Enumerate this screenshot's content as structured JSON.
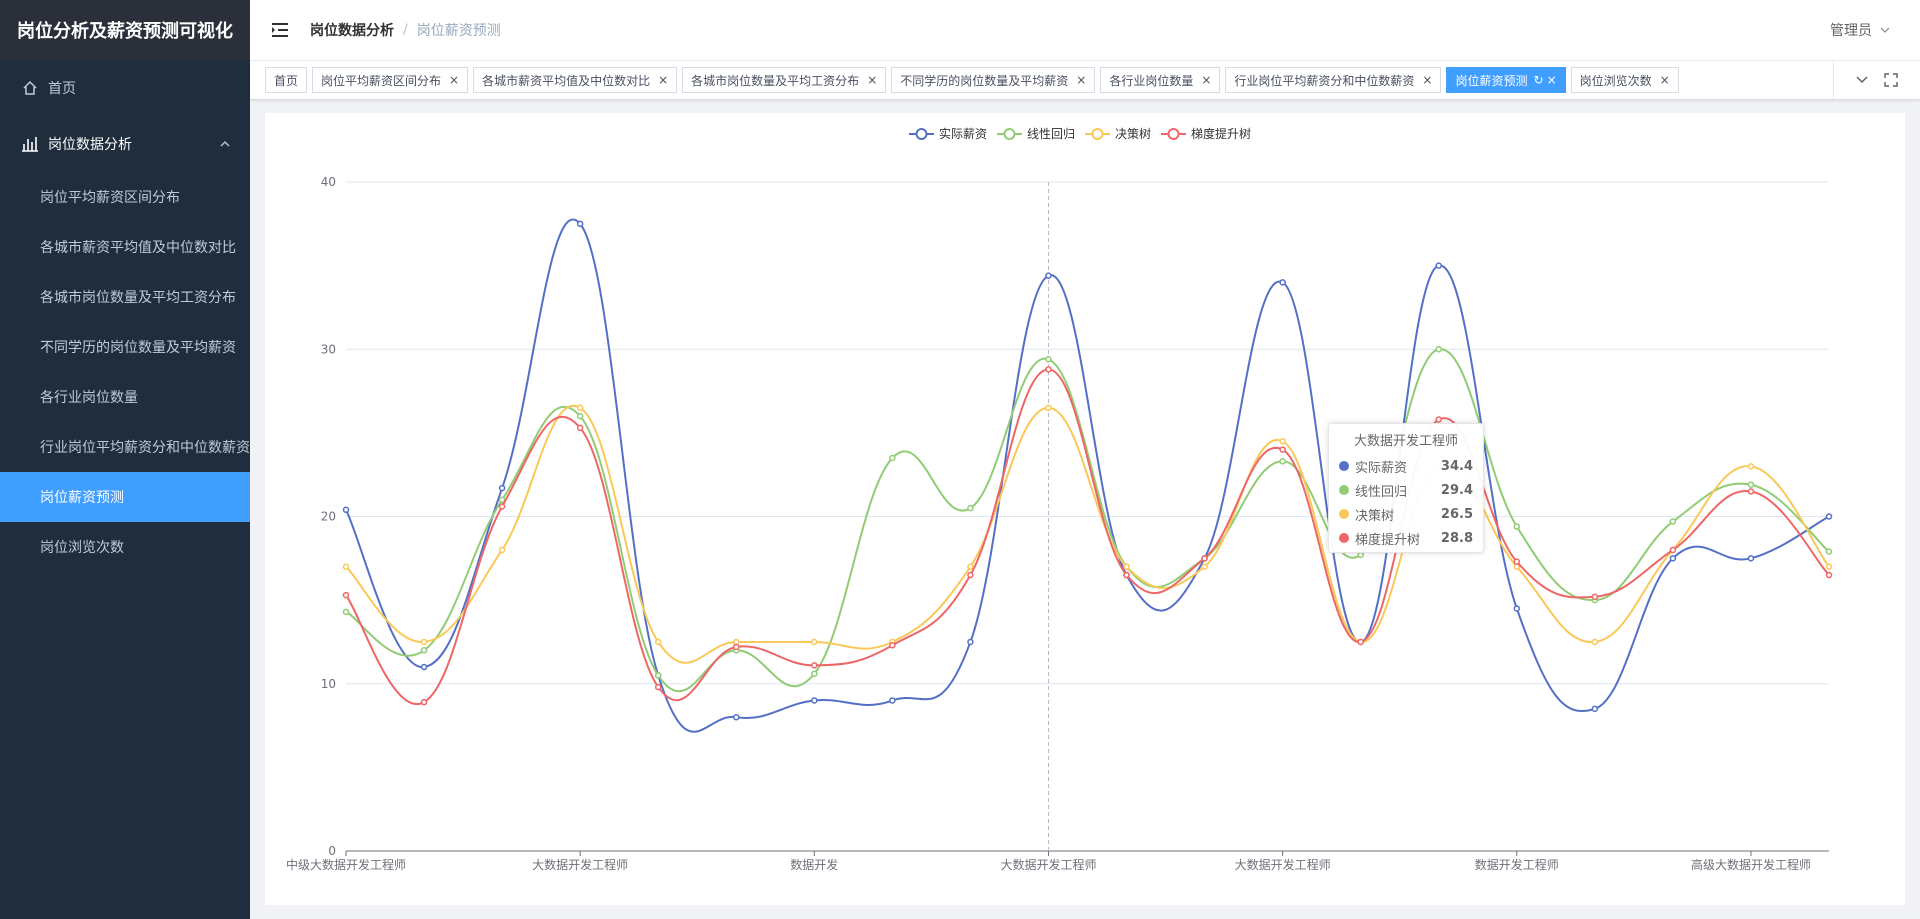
{
  "app": {
    "title": "岗位分析及薪资预测可视化"
  },
  "sidebar": {
    "home": "首页",
    "group": "岗位数据分析",
    "items": [
      {
        "label": "岗位平均薪资区间分布"
      },
      {
        "label": "各城市薪资平均值及中位数对比"
      },
      {
        "label": "各城市岗位数量及平均工资分布"
      },
      {
        "label": "不同学历的岗位数量及平均薪资"
      },
      {
        "label": "各行业岗位数量"
      },
      {
        "label": "行业岗位平均薪资分和中位数薪资"
      },
      {
        "label": "岗位薪资预测"
      },
      {
        "label": "岗位浏览次数"
      }
    ],
    "active_index": 6
  },
  "navbar": {
    "breadcrumb": [
      "岗位数据分析",
      "岗位薪资预测"
    ],
    "user": "管理员"
  },
  "tags": [
    {
      "label": "首页",
      "closable": false
    },
    {
      "label": "岗位平均薪资区间分布",
      "closable": true
    },
    {
      "label": "各城市薪资平均值及中位数对比",
      "closable": true
    },
    {
      "label": "各城市岗位数量及平均工资分布",
      "closable": true
    },
    {
      "label": "不同学历的岗位数量及平均薪资",
      "closable": true
    },
    {
      "label": "各行业岗位数量",
      "closable": true
    },
    {
      "label": "行业岗位平均薪资分和中位数薪资",
      "closable": true
    },
    {
      "label": "岗位薪资预测",
      "closable": true,
      "active": true
    },
    {
      "label": "岗位浏览次数",
      "closable": true
    }
  ],
  "colors": {
    "accent": "#409eff",
    "sidebar": "#1f2d3d"
  },
  "chart_data": {
    "type": "line",
    "smooth": true,
    "legend_position": "top-center",
    "ylim": [
      0,
      40
    ],
    "y_ticks": [
      0,
      10,
      20,
      30,
      40
    ],
    "x_tick_labels": [
      "中级大数据开发工程师",
      "大数据开发工程师",
      "数据开发",
      "大数据开发工程师",
      "大数据开发工程师",
      "数据开发工程师",
      "高级大数据开发工程师"
    ],
    "x_tick_indices": [
      0,
      3,
      6,
      9,
      12,
      15,
      18
    ],
    "n_points": 20,
    "series": [
      {
        "name": "实际薪资",
        "color": "#5470c6",
        "values": [
          20.4,
          11.0,
          21.7,
          37.5,
          10.5,
          8.0,
          9.0,
          9.0,
          12.5,
          34.4,
          16.5,
          17.5,
          34.0,
          12.5,
          35.0,
          14.5,
          8.5,
          17.5,
          17.5,
          20.0
        ]
      },
      {
        "name": "线性回归",
        "color": "#91cc75",
        "values": [
          14.3,
          12.0,
          21.0,
          26.0,
          10.5,
          12.0,
          10.6,
          23.5,
          20.5,
          29.4,
          17.0,
          17.5,
          23.3,
          17.7,
          30.0,
          19.4,
          15.0,
          19.7,
          21.9,
          17.9
        ]
      },
      {
        "name": "决策树",
        "color": "#fac858",
        "values": [
          17.0,
          12.5,
          18.0,
          26.5,
          12.5,
          12.5,
          12.5,
          12.5,
          17.0,
          26.5,
          17.0,
          17.0,
          24.5,
          12.5,
          23.0,
          17.0,
          12.5,
          18.0,
          23.0,
          17.0
        ]
      },
      {
        "name": "梯度提升树",
        "color": "#ee6666",
        "values": [
          15.3,
          8.9,
          20.6,
          25.3,
          9.8,
          12.2,
          11.1,
          12.3,
          16.5,
          28.8,
          16.5,
          17.5,
          24.0,
          12.5,
          25.8,
          17.3,
          15.2,
          18.0,
          21.5,
          16.5
        ]
      }
    ],
    "tooltip": {
      "title": "大数据开发工程师",
      "rows": [
        {
          "name": "实际薪资",
          "value": "34.4",
          "color": "#5470c6"
        },
        {
          "name": "线性回归",
          "value": "29.4",
          "color": "#91cc75"
        },
        {
          "name": "决策树",
          "value": "26.5",
          "color": "#fac858"
        },
        {
          "name": "梯度提升树",
          "value": "28.8",
          "color": "#ee6666"
        }
      ]
    }
  }
}
